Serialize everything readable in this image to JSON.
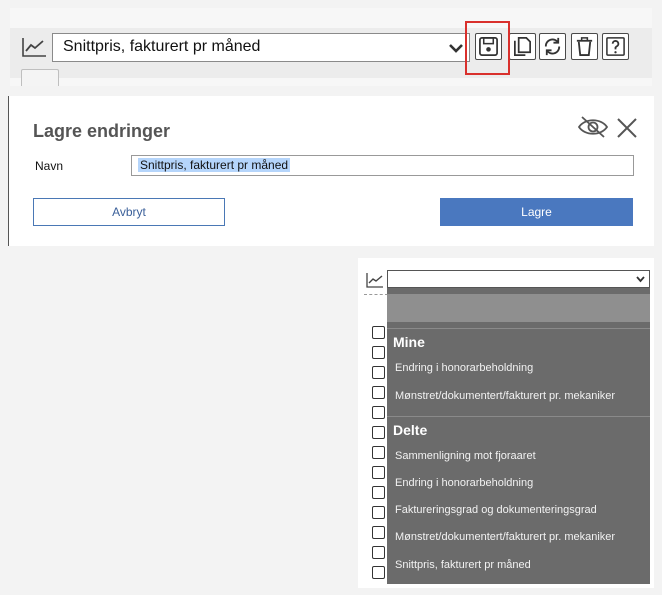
{
  "toolbar": {
    "selected_report": "Snittpris, fakturert pr måned",
    "icons": [
      "chart-icon",
      "save-icon",
      "copy-icon",
      "refresh-icon",
      "delete-icon",
      "help-icon"
    ],
    "highlight_color": "#d9302c"
  },
  "dialog": {
    "title": "Lagre endringer",
    "name_label": "Navn",
    "name_value": "Snittpris, fakturert pr måned",
    "cancel_label": "Avbryt",
    "save_label": "Lagre",
    "save_color": "#4a78bf"
  },
  "dropdown": {
    "groups": [
      {
        "label": "Mine",
        "items": [
          "Endring i honorarbeholdning",
          "Mønstret/dokumentert/fakturert pr. mekaniker"
        ]
      },
      {
        "label": "Delte",
        "items": [
          "Sammenligning mot fjoraaret",
          "Endring i honorarbeholdning",
          "Faktureringsgrad og dokumenteringsgrad",
          "Mønstret/dokumentert/fakturert pr. mekaniker",
          "Snittpris, fakturert pr måned"
        ]
      }
    ]
  }
}
